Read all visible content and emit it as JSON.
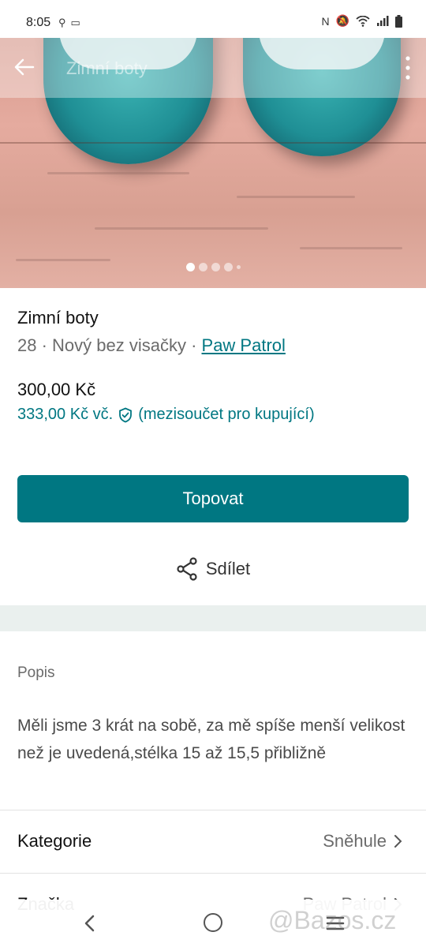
{
  "status_bar": {
    "time": "8:05",
    "left_icons": [
      "location-icon",
      "message-icon"
    ],
    "right_icons": [
      "nfc-icon",
      "mute-icon",
      "wifi-icon",
      "signal-icon",
      "battery-icon"
    ]
  },
  "app_bar": {
    "title": "Zimní boty",
    "back_icon": "arrow-left-icon",
    "menu_icon": "more-vertical-icon"
  },
  "gallery": {
    "image_count_dots": 5,
    "active_index": 0
  },
  "item": {
    "title": "Zimní boty",
    "size_condition": "28 · Nový bez visačky · ",
    "brand": "Paw Patrol",
    "price": "300,00 Kč",
    "buyer_price": "333,00 Kč  vč.",
    "buyer_note": "(mezisoučet pro kupující)"
  },
  "actions": {
    "bump_label": "Topovat",
    "share_label": "Sdílet"
  },
  "description": {
    "label": "Popis",
    "text": "Měli jsme 3 krát na sobě, za mě spíše menší velikost než je uvedená,stélka 15 až 15,5 přibližně"
  },
  "details": [
    {
      "label": "Kategorie",
      "value": "Sněhule"
    },
    {
      "label": "Značka",
      "value": "Paw Patrol"
    }
  ],
  "watermark": "@Bazos.cz",
  "colors": {
    "accent": "#007782",
    "band": "#eaf0ee"
  }
}
